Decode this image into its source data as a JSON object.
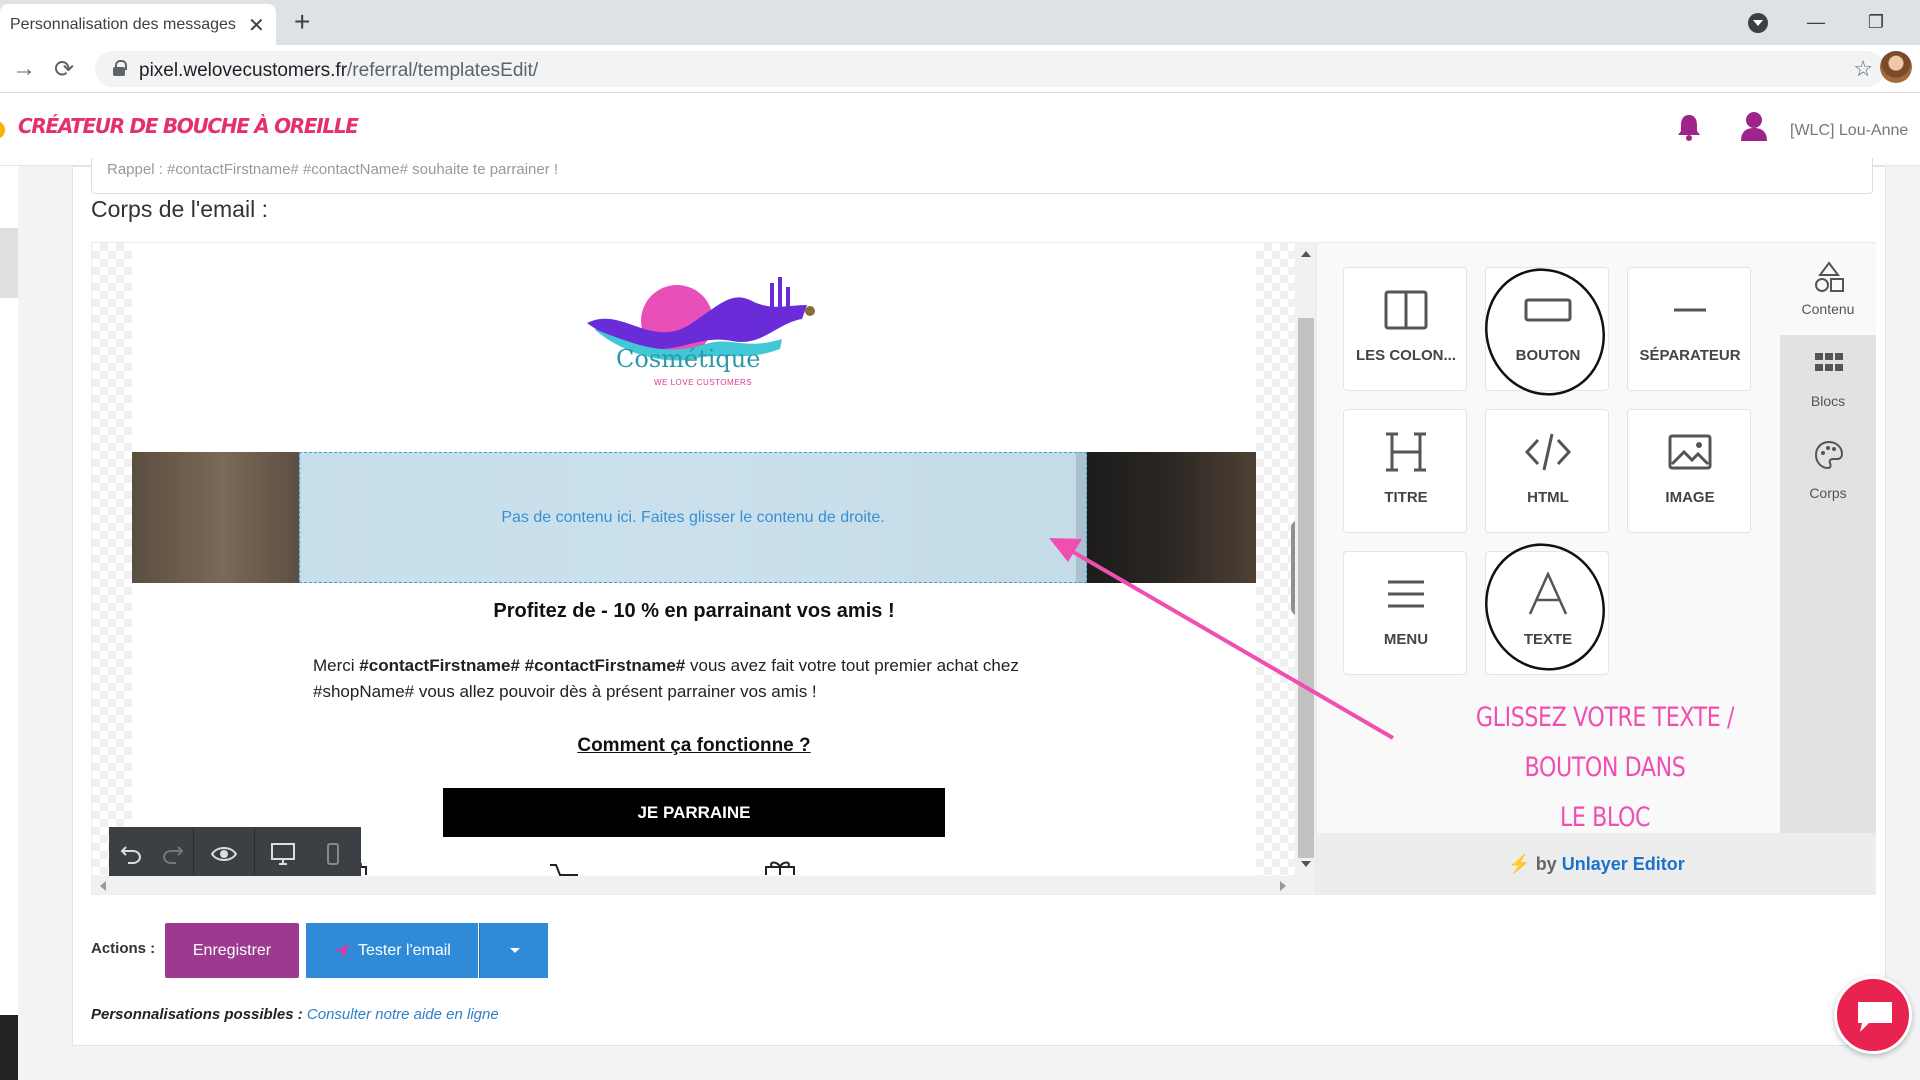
{
  "browser": {
    "tab_title": "Personnalisation des messages WLC",
    "tab_close": "✕",
    "new_tab": "+",
    "url_host": "pixel.welovecustomers.fr",
    "url_path": "/referral/templatesEdit/",
    "back_icon": "→",
    "reload_icon": "⟳",
    "star_icon": "☆",
    "minimize": "—",
    "restore": "❐"
  },
  "header": {
    "brand": "Créateur de bouche à oreille",
    "user_name": "[WLC] Lou-Anne",
    "accent_color": "#a0238c"
  },
  "form": {
    "subject_text": "Rappel : #contactFirstname# #contactName# souhaite te parrainer !",
    "body_label": "Corps de l'email :"
  },
  "email": {
    "logo_text": "Cosmétique",
    "logo_subtitle": "WE LOVE CUSTOMERS",
    "dropzone_text": "Pas de contenu ici. Faites glisser le contenu de droite.",
    "title": "Profitez de - 10 % en parrainant vos amis !",
    "body_pre": "Merci ",
    "body_var1": "#contactFirstname#",
    "body_var2": "#contactFirstname#",
    "body_post": " vous avez fait votre tout premier achat chez #shopName# vous allez pouvoir dès à présent parrainer vos amis !",
    "how_link": "Comment ça fonctionne ?",
    "cta": "JE PARRAINE"
  },
  "panel": {
    "tiles": [
      {
        "label": "LES COLON...",
        "icon": "columns-icon"
      },
      {
        "label": "BOUTON",
        "icon": "button-icon"
      },
      {
        "label": "SÉPARATEUR",
        "icon": "divider-icon"
      },
      {
        "label": "TITRE",
        "icon": "heading-icon"
      },
      {
        "label": "HTML",
        "icon": "code-icon"
      },
      {
        "label": "IMAGE",
        "icon": "image-icon"
      },
      {
        "label": "MENU",
        "icon": "menu-icon"
      },
      {
        "label": "TEXTE",
        "icon": "text-icon"
      }
    ],
    "tabs": [
      "Contenu",
      "Blocs",
      "Corps"
    ],
    "footer_by": "by",
    "footer_brand": "Unlayer Editor"
  },
  "annotation": {
    "line1": "GLISSEZ  VOTRE  TEXTE / BOUTON DANS",
    "line2": "LE BLOC",
    "color": "#f04fb1"
  },
  "actions": {
    "label": "Actions :",
    "save": "Enregistrer",
    "test": "Tester l'email",
    "perso_label": "Personnalisations possibles :",
    "perso_link": "Consulter notre aide en ligne"
  }
}
